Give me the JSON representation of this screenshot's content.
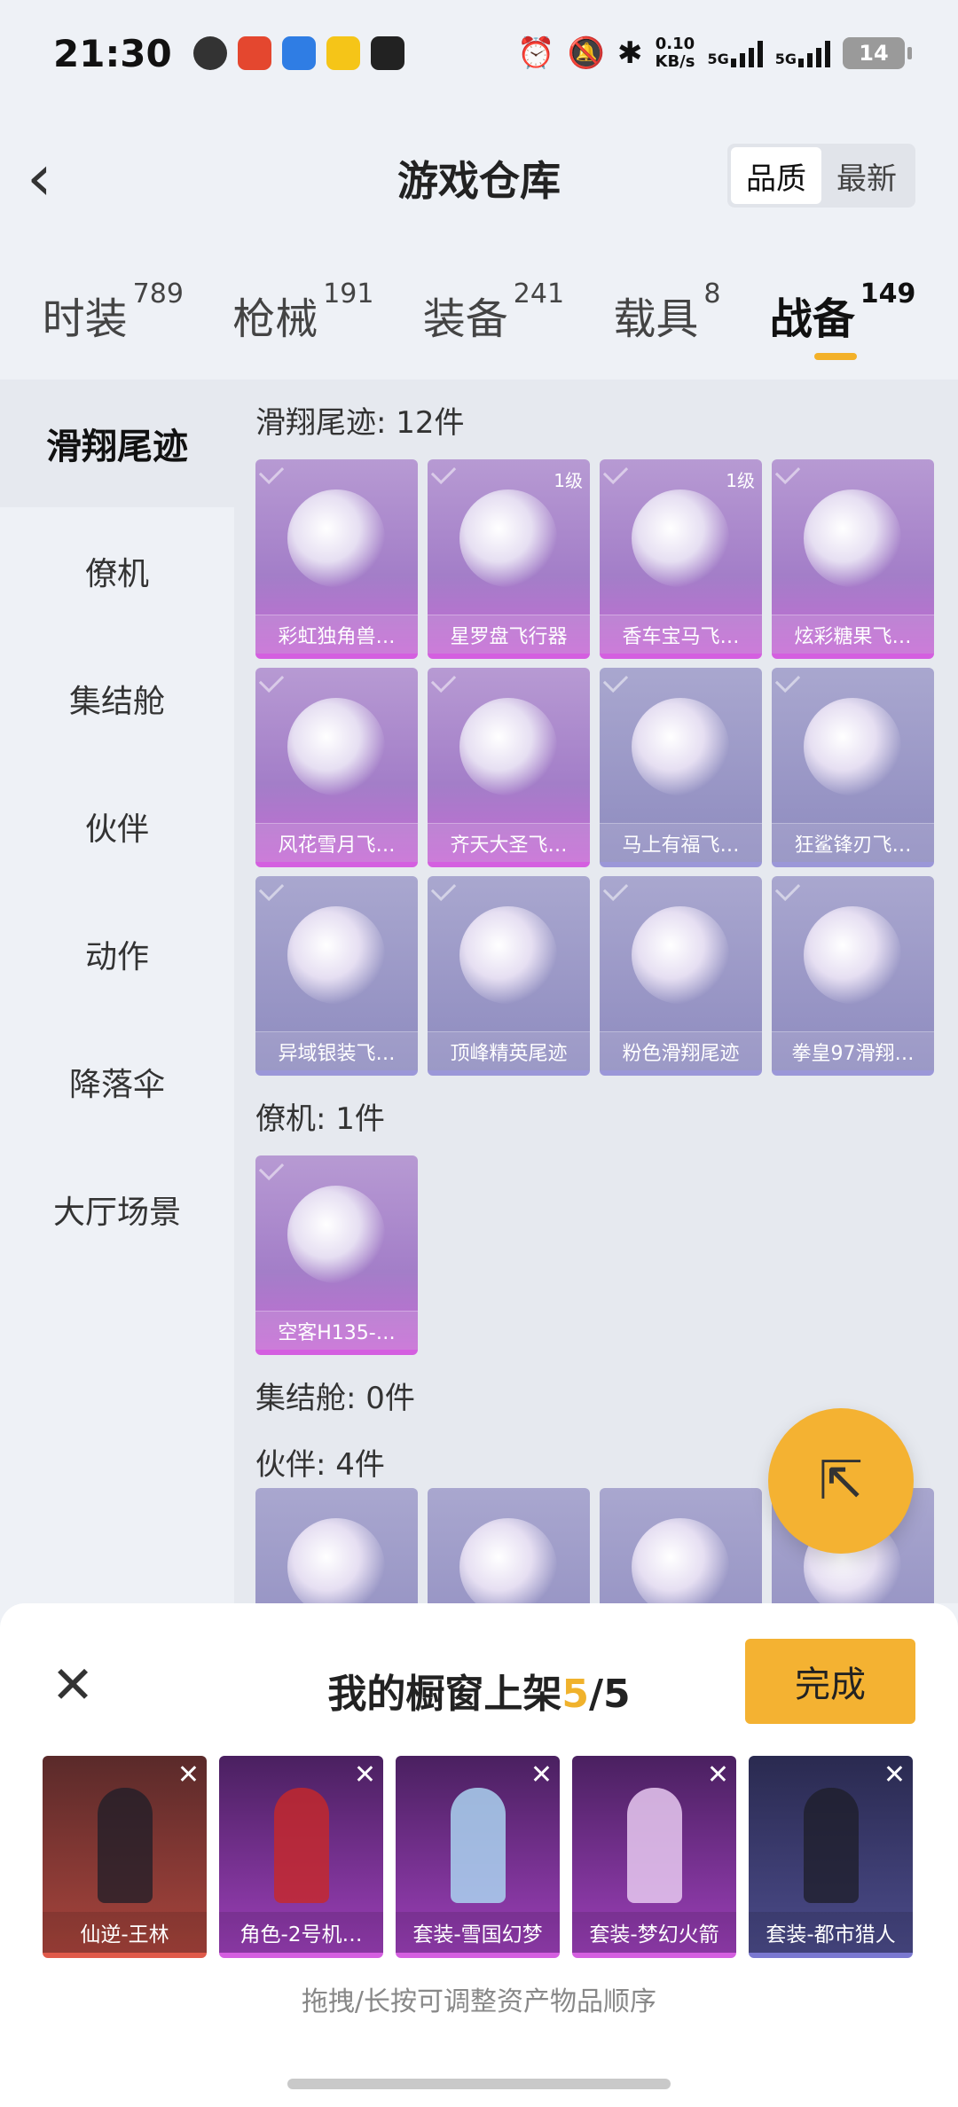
{
  "status_bar": {
    "time": "21:30",
    "net_speed": "0.10",
    "net_unit": "KB/s",
    "net1": "5G",
    "net2": "5G",
    "battery": "14"
  },
  "header": {
    "title": "游戏仓库",
    "sort_quality": "品质",
    "sort_latest": "最新"
  },
  "tabs": [
    {
      "label": "时装",
      "count": "789"
    },
    {
      "label": "枪械",
      "count": "191"
    },
    {
      "label": "装备",
      "count": "241"
    },
    {
      "label": "载具",
      "count": "8"
    },
    {
      "label": "战备",
      "count": "149"
    }
  ],
  "sidebar": [
    "滑翔尾迹",
    "僚机",
    "集结舱",
    "伙伴",
    "动作",
    "降落伞",
    "大厅场景"
  ],
  "sections": {
    "glide": {
      "title": "滑翔尾迹: 12件",
      "items": [
        {
          "name": "彩虹独角兽…",
          "level": ""
        },
        {
          "name": "星罗盘飞行器",
          "level": "1级"
        },
        {
          "name": "香车宝马飞…",
          "level": "1级"
        },
        {
          "name": "炫彩糖果飞…",
          "level": ""
        },
        {
          "name": "风花雪月飞…",
          "level": ""
        },
        {
          "name": "齐天大圣飞…",
          "level": ""
        },
        {
          "name": "马上有福飞…",
          "level": ""
        },
        {
          "name": "狂鲨锋刃飞…",
          "level": ""
        },
        {
          "name": "异域银装飞…",
          "level": ""
        },
        {
          "name": "顶峰精英尾迹",
          "level": ""
        },
        {
          "name": "粉色滑翔尾迹",
          "level": ""
        },
        {
          "name": "拳皇97滑翔…",
          "level": ""
        }
      ]
    },
    "wingman": {
      "title": "僚机: 1件",
      "items": [
        {
          "name": "空客H135-…"
        }
      ]
    },
    "assembly": {
      "title": "集结舱: 0件"
    },
    "partner": {
      "title": "伙伴: 4件"
    }
  },
  "sheet": {
    "title_prefix": "我的橱窗上架",
    "count": "5",
    "total": "/5",
    "done": "完成",
    "hint": "拖拽/长按可调整资产物品顺序",
    "items": [
      "仙逆-王林",
      "角色-2号机…",
      "套装-雪国幻梦",
      "套装-梦幻火箭",
      "套装-都市猎人"
    ]
  },
  "colors": {
    "accent": "#f4b232",
    "card_purple": "#a37ec8",
    "card_blue": "#8e8bbf"
  }
}
